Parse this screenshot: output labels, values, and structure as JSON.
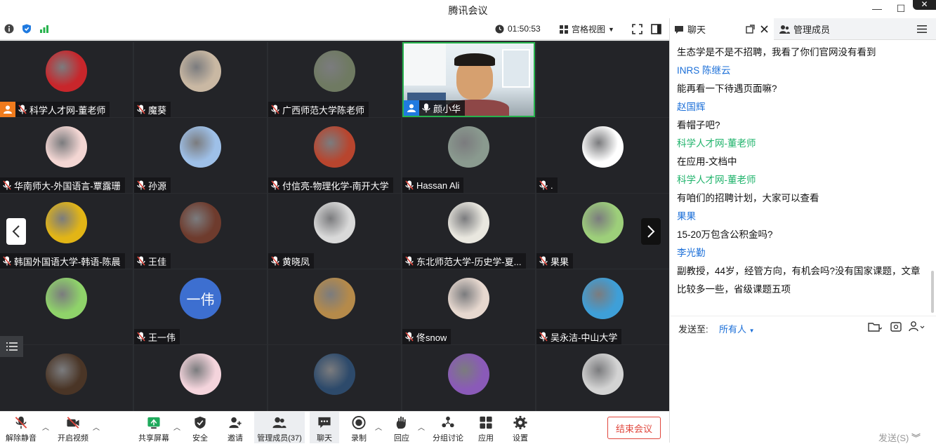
{
  "window": {
    "title": "腾讯会议"
  },
  "meetbar": {
    "timer": "01:50:53",
    "view_label": "宫格视图"
  },
  "tiles": [
    {
      "name": "科学人才网-董老师",
      "host": true,
      "color": "#c8262b"
    },
    {
      "name": "魔葵",
      "color": "#c9b8a3"
    },
    {
      "name": "广西师范大学陈老师",
      "color": "#6f7a62"
    },
    {
      "name": "颜小华",
      "host_blue": true,
      "video": true
    },
    {
      "name": "",
      "hidden": true,
      "color": "#d8e6ef"
    },
    {
      "name": "华南师大-外国语言-覃露珊",
      "color": "#f3d6d3"
    },
    {
      "name": "孙源",
      "color": "#9ec0e8"
    },
    {
      "name": "付信亮-物理化学-南开大学",
      "color": "#b8452e"
    },
    {
      "name": "Hassan Ali",
      "color": "#8a9a8f"
    },
    {
      "name": ".",
      "color": "#ffffff"
    },
    {
      "name": "韩国外国语大学-韩语-陈晨",
      "color": "#e2b516"
    },
    {
      "name": "王佳",
      "color": "#6e3b2d"
    },
    {
      "name": "黄晓凤",
      "color": "#d9d9d9"
    },
    {
      "name": "东北师范大学-历史学-夏...",
      "color": "#e9e7df"
    },
    {
      "name": "果果",
      "color": "#9dcf7a"
    },
    {
      "name": "",
      "color": "#8fd36a"
    },
    {
      "name": "王一伟",
      "color": "#3d6fd0",
      "initials": "一伟"
    },
    {
      "name": "",
      "color": "#b58a4a"
    },
    {
      "name": "佟snow",
      "color": "#e7d8cf"
    },
    {
      "name": "吴永洁-中山大学",
      "color": "#3e9fd8"
    },
    {
      "name": "",
      "color": "#4a3526"
    },
    {
      "name": "",
      "color": "#f4d4dc"
    },
    {
      "name": "",
      "color": "#2d4a6b"
    },
    {
      "name": "",
      "color": "#8a5ab8"
    },
    {
      "name": "",
      "color": "#d3d3d3"
    }
  ],
  "bottombar": {
    "unmute": "解除静音",
    "video": "开启视频",
    "share": "共享屏幕",
    "security": "安全",
    "invite": "邀请",
    "members": "管理成员(37)",
    "chat": "聊天",
    "record": "录制",
    "react": "回应",
    "breakout": "分组讨论",
    "apps": "应用",
    "settings": "设置",
    "end": "结束会议"
  },
  "panel": {
    "tab_chat": "聊天",
    "tab_members": "管理成员",
    "messages": [
      {
        "text": "生态学是不是不招聘，我看了你们官网没有看到",
        "style": "text"
      },
      {
        "text": "INRS 陈继云",
        "style": "blue"
      },
      {
        "text": "能再看一下待遇页面嘛?",
        "style": "text"
      },
      {
        "text": "赵国辉",
        "style": "blue"
      },
      {
        "text": "看帽子吧?",
        "style": "text"
      },
      {
        "text": "科学人才网-董老师",
        "style": "green"
      },
      {
        "text": "在应用-文档中",
        "style": "text"
      },
      {
        "text": "科学人才网-董老师",
        "style": "green"
      },
      {
        "text": "有咱们的招聘计划，大家可以查看",
        "style": "text"
      },
      {
        "text": "果果",
        "style": "blue"
      },
      {
        "text": "15-20万包含公积金吗?",
        "style": "text"
      },
      {
        "text": "李光勤",
        "style": "blue"
      },
      {
        "text": "副教授，44岁，经管方向，有机会吗?没有国家课题，文章比较多一些，省级课题五项",
        "style": "text"
      }
    ],
    "send_to_label": "发送至:",
    "send_to_value": "所有人",
    "send_button": "发送(S)"
  }
}
